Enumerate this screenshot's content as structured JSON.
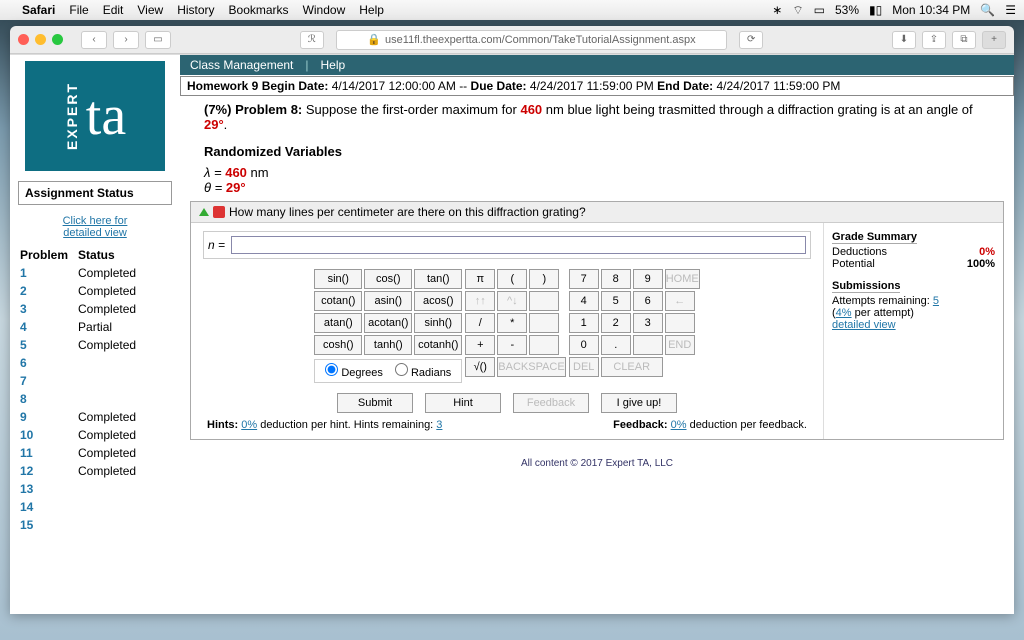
{
  "menubar": {
    "app": "Safari",
    "items": [
      "File",
      "Edit",
      "View",
      "History",
      "Bookmarks",
      "Window",
      "Help"
    ],
    "battery": "53%",
    "clock": "Mon 10:34 PM"
  },
  "browser": {
    "url": "use11fl.theexpertta.com/Common/TakeTutorialAssignment.aspx"
  },
  "tabs": {
    "class": "Class Management",
    "help": "Help"
  },
  "hw": {
    "label": "Homework 9",
    "begin_l": "Begin Date:",
    "begin": "4/14/2017 12:00:00 AM",
    "sep": "--",
    "due_l": "Due Date:",
    "due": "4/24/2017 11:59:00 PM",
    "end_l": "End Date:",
    "end": "4/24/2017 11:59:00 PM"
  },
  "problem": {
    "pct": "(7%)",
    "label": "Problem 8:",
    "t1": "Suppose the first-order maximum for ",
    "t1v": "460",
    "t2": " nm blue light being trasmitted through a diffraction grating is at an angle of ",
    "t2v": "29°",
    "t3": ".",
    "rv": "Randomized Variables",
    "lam_l": "λ = ",
    "lam_v": "460",
    "lam_u": " nm",
    "th_l": "θ = ",
    "th_v": "29°"
  },
  "question": "How many lines per centimeter are there on this diffraction grating?",
  "n_label": "n = ",
  "keys": {
    "r1": [
      "sin()",
      "cos()",
      "tan()"
    ],
    "r2": [
      "cotan()",
      "asin()",
      "acos()"
    ],
    "r3": [
      "atan()",
      "acotan()",
      "sinh()"
    ],
    "r4": [
      "cosh()",
      "tanh()",
      "cotanh()"
    ],
    "pi": "π",
    "lp": "(",
    "rp": ")",
    "n7": "7",
    "n8": "8",
    "n9": "9",
    "home": "HOME",
    "up": "↑↑",
    "dn": "^↓",
    "n4": "4",
    "n5": "5",
    "n6": "6",
    "bk": "←",
    "sl": "/",
    "mul": "*",
    "n1": "1",
    "n2": "2",
    "n3": "3",
    "plus": "+",
    "minus": "-",
    "n0": "0",
    "dot": ".",
    "end": "END",
    "sqrt": "√()",
    "bksp": "BACKSPACE",
    "del": "DEL",
    "clr": "CLEAR",
    "deg": "Degrees",
    "rad": "Radians"
  },
  "actions": {
    "submit": "Submit",
    "hint": "Hint",
    "feedback": "Feedback",
    "giveup": "I give up!"
  },
  "hints": {
    "l1": "Hints: ",
    "v1": "0%",
    "l2": " deduction per hint. Hints remaining: ",
    "v2": "3",
    "fl": "Feedback: ",
    "fv": "0%",
    "ft": " deduction per feedback."
  },
  "summary": {
    "t1": "Grade Summary",
    "d": "Deductions",
    "dv": "0%",
    "p": "Potential",
    "pv": "100%",
    "t2": "Submissions",
    "a": "Attempts remaining: ",
    "av": "5",
    "per": "(",
    "perv": "4%",
    "per2": " per attempt)",
    "dview": "detailed view"
  },
  "side": {
    "as": "Assignment Status",
    "click": "Click here for",
    "click2": "detailed view",
    "prob": "Problem",
    "stat": "Status",
    "rows": [
      [
        "1",
        "Completed"
      ],
      [
        "2",
        "Completed"
      ],
      [
        "3",
        "Completed"
      ],
      [
        "4",
        "Partial"
      ],
      [
        "5",
        "Completed"
      ],
      [
        "6",
        ""
      ],
      [
        "7",
        ""
      ],
      [
        "8",
        ""
      ],
      [
        "9",
        "Completed"
      ],
      [
        "10",
        "Completed"
      ],
      [
        "11",
        "Completed"
      ],
      [
        "12",
        "Completed"
      ],
      [
        "13",
        ""
      ],
      [
        "14",
        ""
      ],
      [
        "15",
        ""
      ]
    ]
  },
  "signature": "EXPERT ta",
  "footer": "All content © 2017 Expert TA, LLC"
}
